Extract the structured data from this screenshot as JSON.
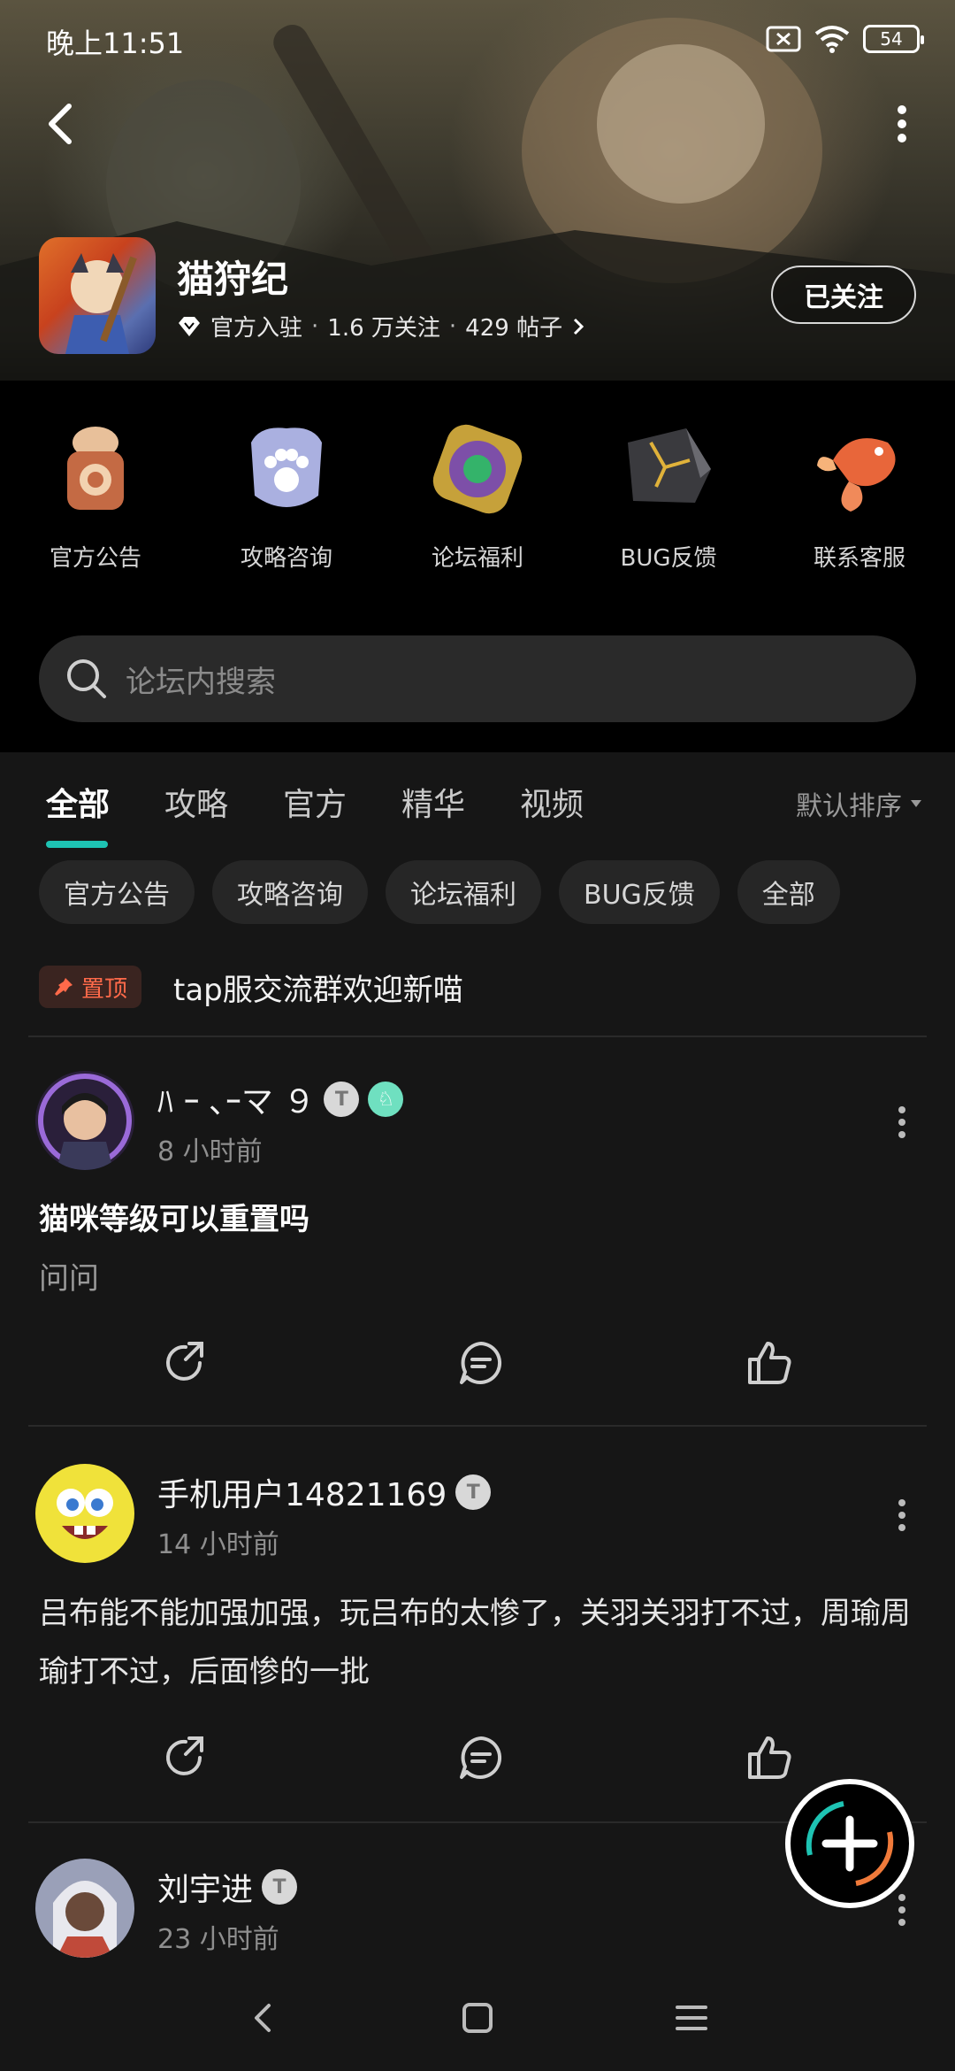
{
  "status_bar": {
    "time": "晚上11:51",
    "battery": "54"
  },
  "header": {
    "game_title": "猫狩纪",
    "official_label": "官方入驻",
    "followers": "1.6 万关注",
    "posts": "429 帖子",
    "follow_button": "已关注"
  },
  "categories": [
    {
      "label": "官方公告",
      "icon": "announcement-token-icon"
    },
    {
      "label": "攻略咨询",
      "icon": "paw-badge-icon"
    },
    {
      "label": "论坛福利",
      "icon": "jade-medallion-icon"
    },
    {
      "label": "BUG反馈",
      "icon": "cracked-stone-icon"
    },
    {
      "label": "联系客服",
      "icon": "koi-fish-icon"
    }
  ],
  "search": {
    "placeholder": "论坛内搜索"
  },
  "tabs": [
    {
      "label": "全部",
      "active": true
    },
    {
      "label": "攻略",
      "active": false
    },
    {
      "label": "官方",
      "active": false
    },
    {
      "label": "精华",
      "active": false
    },
    {
      "label": "视频",
      "active": false
    }
  ],
  "sort": {
    "label": "默认排序"
  },
  "chips": [
    "官方公告",
    "攻略咨询",
    "论坛福利",
    "BUG反馈",
    "全部"
  ],
  "pinned": {
    "badge": "置顶",
    "title": "tap服交流群欢迎新喵"
  },
  "posts": [
    {
      "author": "ﾊ ｰ ､ｰマ ９",
      "time": "8 小时前",
      "title": "猫咪等级可以重置吗",
      "body": "问问",
      "badges": [
        "T",
        "♘"
      ]
    },
    {
      "author": "手机用户14821169",
      "time": "14 小时前",
      "title": "",
      "body": "吕布能不能加强加强，玩吕布的太惨了，关羽关羽打不过，周瑜周瑜打不过，后面惨的一批",
      "badges": [
        "T"
      ]
    },
    {
      "author": "刘宇进",
      "time": "23 小时前",
      "title": "",
      "body": "",
      "badges": [
        "T"
      ]
    }
  ],
  "colors": {
    "accent": "#1ec3b3",
    "pin": "#ff6a4a",
    "background": "#161616"
  }
}
